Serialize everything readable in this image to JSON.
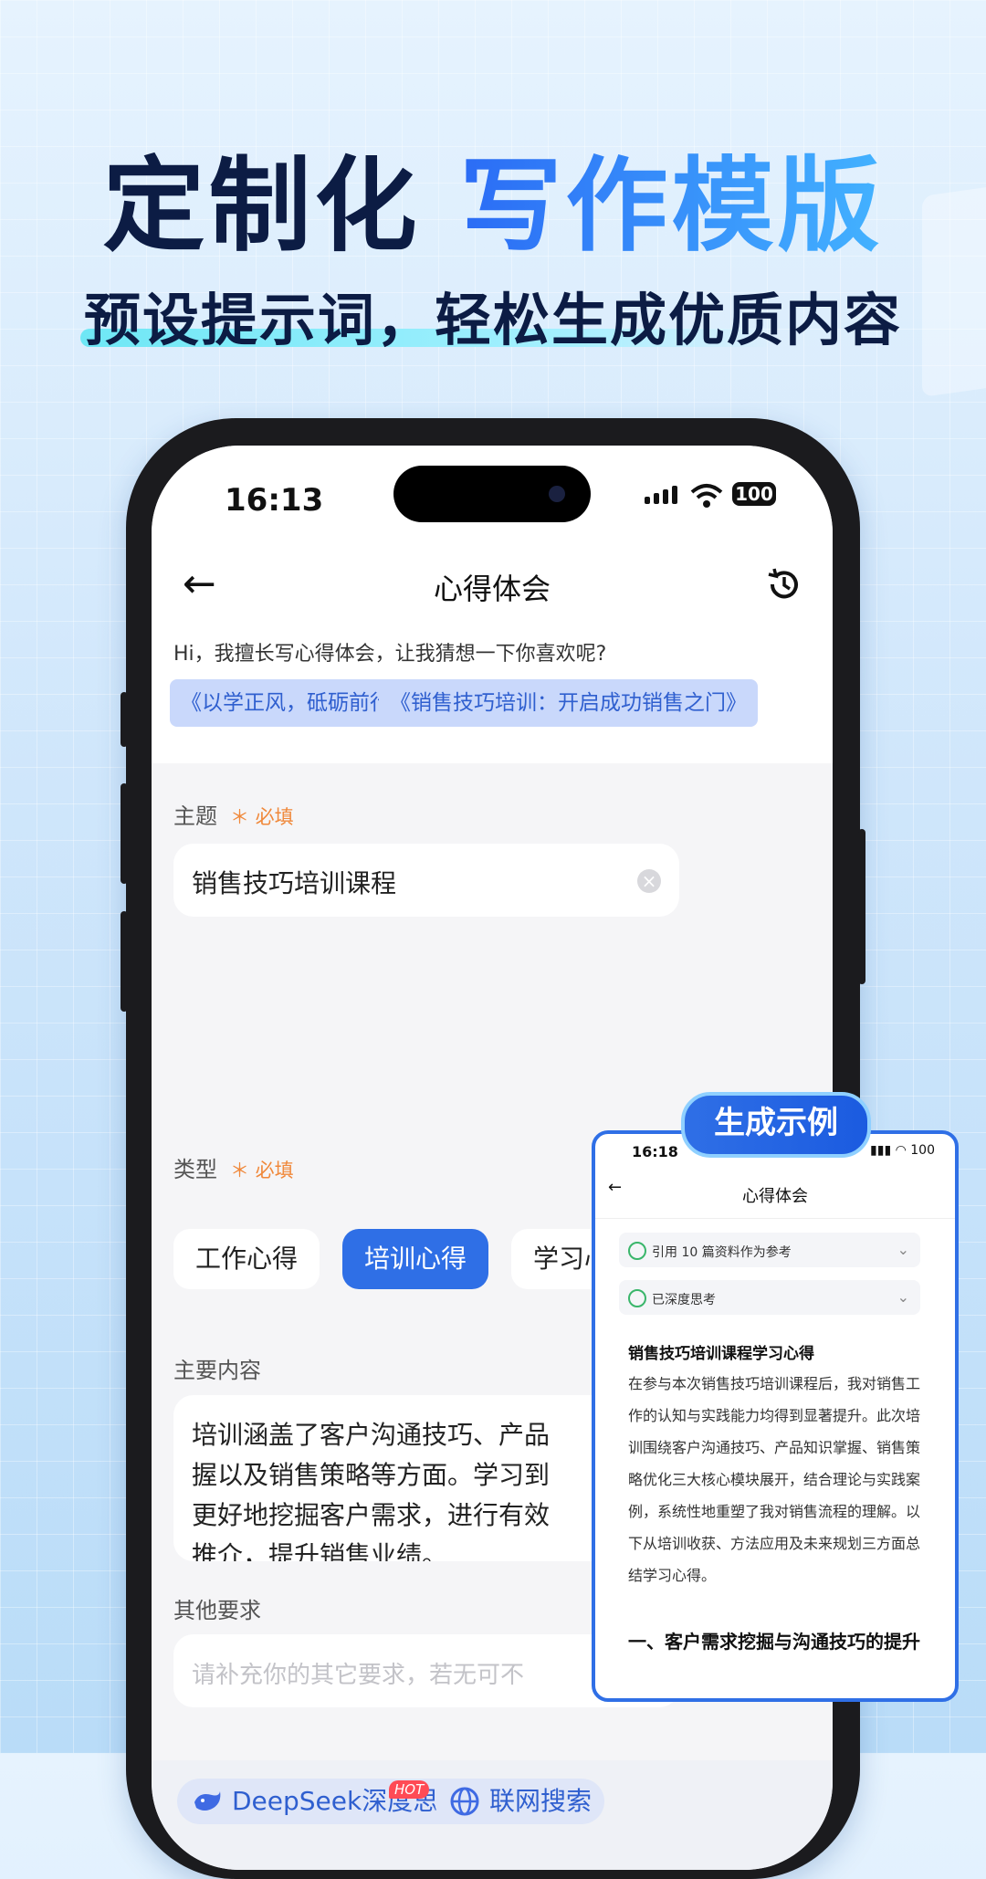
{
  "hero": {
    "title_dark": "定制化",
    "title_blue": "写作模版",
    "subtitle": "预设提示词，轻松生成优质内容"
  },
  "status": {
    "time": "16:13",
    "battery": "100"
  },
  "appbar": {
    "title": "心得体会"
  },
  "intro": {
    "greeting": "Hi，我擅长写心得体会，让我猜想一下你喜欢呢?",
    "suggestions": [
      "《以学正风，砥砺前行》",
      "《销售技巧培训：开启成功销售之门》"
    ]
  },
  "form": {
    "topic_label": "主题",
    "required": "＊ 必填",
    "topic_value": "销售技巧培训课程",
    "type_label": "类型",
    "types": [
      "工作心得",
      "培训心得",
      "学习心得"
    ],
    "selected_type": "培训心得",
    "content_label": "主要内容",
    "content_value": "培训涵盖了客户沟通技巧、产品知识掌握以及销售策略等方面。学习到了如何更好地挖掘客户需求，进行有效的产品推介，提升销售业绩。",
    "content_lines": [
      "培训涵盖了客户沟通技巧、产品",
      "握以及销售策略等方面。学习到",
      "更好地挖掘客户需求，进行有效",
      "推介，提升销售业绩。"
    ],
    "other_label": "其他要求",
    "other_placeholder": "请补充你的其它要求，若无可不"
  },
  "bottom": {
    "deepseek": "DeepSeek深度思考",
    "hot": "HOT",
    "web": "联网搜索"
  },
  "preview": {
    "badge": "生成示例",
    "time": "16:18",
    "battery": "100",
    "title": "心得体会",
    "row1": "引用 10 篇资料作为参考",
    "row2": "已深度思考",
    "heading": "销售技巧培训课程学习心得",
    "body": "在参与本次销售技巧培训课程后，我对销售工作的认知与实践能力均得到显著提升。此次培训围绕客户沟通技巧、产品知识掌握、销售策略优化三大核心模块展开，结合理论与实践案例，系统性地重塑了我对销售流程的理解。以下从培训收获、方法应用及未来规划三方面总结学习心得。",
    "section": "一、客户需求挖掘与沟通技巧的提升"
  }
}
